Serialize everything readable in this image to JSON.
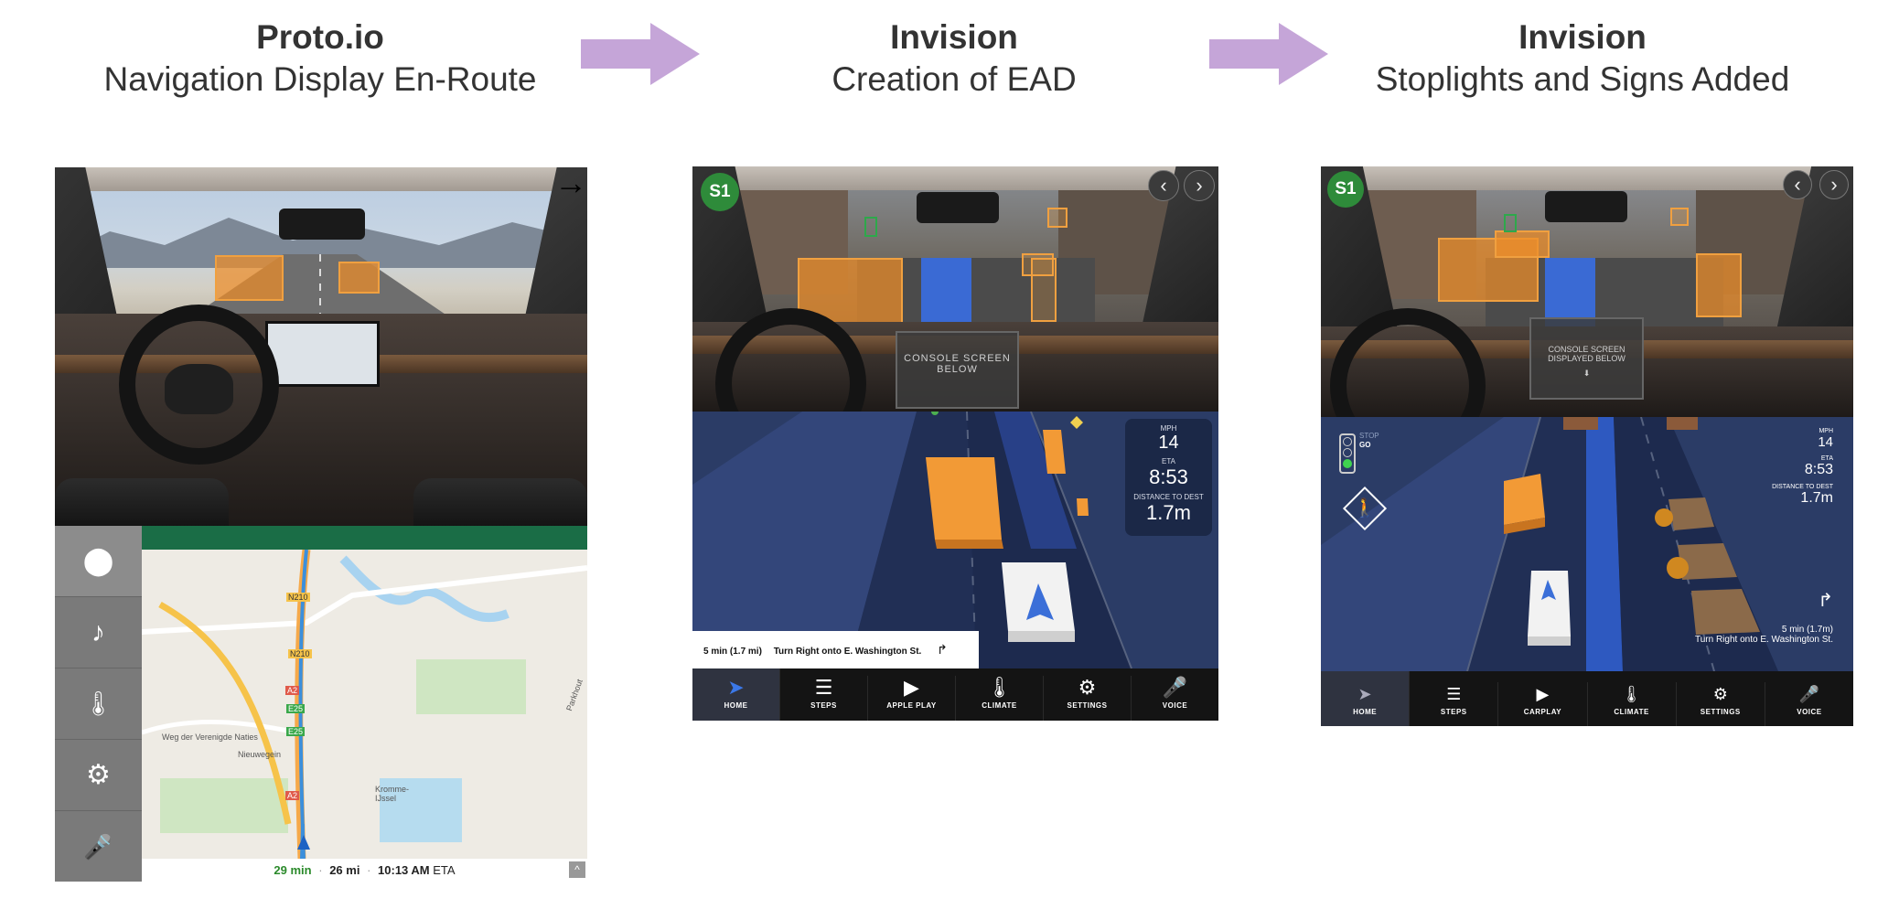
{
  "headings": [
    {
      "tool": "Proto.io",
      "subtitle": "Navigation Display En-Route"
    },
    {
      "tool": "Invision",
      "subtitle": "Creation of EAD"
    },
    {
      "tool": "Invision",
      "subtitle": "Stoplights and Signs Added"
    }
  ],
  "colors": {
    "arrow": "#c5a5d8",
    "badge": "#2e8b3a",
    "bbox": "#ef8e28",
    "ead_bg": "#243459",
    "tabbar": "#141414",
    "map_header": "#1a6d46"
  },
  "panel1": {
    "map_footer": {
      "duration": "29 min",
      "distance": "26 mi",
      "eta_time": "10:13 AM",
      "eta_label": "ETA",
      "sep": "·"
    },
    "map_labels": [
      "N210",
      "N210",
      "A2",
      "E25",
      "E25",
      "A2",
      "Weg der Verenigde Naties",
      "Kromme-IJssel",
      "Parkhout",
      "Nieuwegein"
    ],
    "sidebar_icons": [
      "location-pin-icon",
      "music-note-icon",
      "climate-icon",
      "gear-icon",
      "microphone-icon"
    ],
    "next_arrow": "→"
  },
  "panel2": {
    "badge": "S1",
    "prev": "‹",
    "next": "›",
    "console_box": {
      "line1": "CONSOLE SCREEN",
      "line2": "BELOW"
    },
    "hud": {
      "mph_label": "MPH",
      "mph": "14",
      "eta_label": "ETA",
      "eta": "8:53",
      "dist_label": "DISTANCE TO DEST",
      "dist": "1.7m"
    },
    "turn": {
      "time": "5 min (1.7 mi)",
      "instruction": "Turn Right onto E. Washington St."
    },
    "tabs": [
      "HOME",
      "STEPS",
      "APPLE PLAY",
      "CLIMATE",
      "SETTINGS",
      "VOICE"
    ]
  },
  "panel3": {
    "badge": "S1",
    "prev": "‹",
    "next": "›",
    "console_box": {
      "line1": "CONSOLE SCREEN",
      "line2": "DISPLAYED BELOW"
    },
    "stoplight": {
      "stop": "STOP",
      "go": "GO"
    },
    "hud": {
      "mph_label": "MPH",
      "mph": "14",
      "eta_label": "ETA",
      "eta": "8:53",
      "dist_label": "DISTANCE TO DEST",
      "dist": "1.7m"
    },
    "turn": {
      "time": "5 min (1.7m)",
      "instruction": "Turn Right onto E. Washington St."
    },
    "tabs": [
      "HOME",
      "STEPS",
      "CARPLAY",
      "CLIMATE",
      "SETTINGS",
      "VOICE"
    ]
  }
}
